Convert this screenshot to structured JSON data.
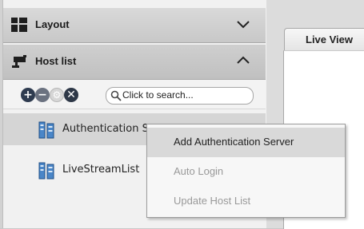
{
  "sidebar": {
    "sections": [
      {
        "label": "Layout",
        "icon": "grid-icon",
        "state": "collapsed"
      },
      {
        "label": "Host list",
        "icon": "camera-icon",
        "state": "expanded"
      }
    ],
    "toolbar": {
      "icons": [
        "plus-icon",
        "minus-icon",
        "gear-icon",
        "close-icon"
      ],
      "search_placeholder": "Click to search..."
    },
    "tree": [
      {
        "label": "Authentication Server"
      },
      {
        "label": "LiveStreamList"
      }
    ]
  },
  "main": {
    "tab_label": "Live View"
  },
  "context_menu": {
    "items": [
      {
        "label": "Add Authentication Server",
        "enabled": true
      },
      {
        "label": "Auto Login",
        "enabled": false
      },
      {
        "label": "Update Host List",
        "enabled": false
      }
    ]
  },
  "colors": {
    "panel_bg": "#f1f1f1",
    "header_bg": "#d2d2d2",
    "selected_row": "#d5d5d5",
    "menu_hover": "#d9d9d9",
    "disabled_text": "#999999",
    "icon_dark": "#2e3b4f",
    "server_icon_blue": "#2f6fb6"
  }
}
